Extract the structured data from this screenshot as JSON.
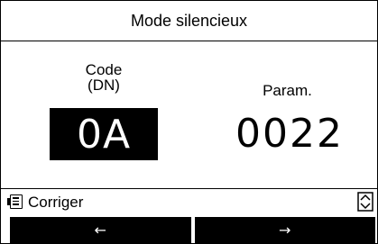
{
  "title": "Mode silencieux",
  "code": {
    "label_line1": "Code",
    "label_line2": "(DN)",
    "value": "0A"
  },
  "param": {
    "label": "Param.",
    "value": "0022"
  },
  "menu": {
    "icon": "menu-list-icon",
    "label": "Corriger",
    "scroll_icon": "up-down-scroll-icon"
  },
  "softkeys": {
    "left": "←",
    "right": "→"
  },
  "colors": {
    "background": "#ffffff",
    "foreground": "#000000",
    "highlight_bg": "#000000",
    "highlight_fg": "#ffffff"
  }
}
